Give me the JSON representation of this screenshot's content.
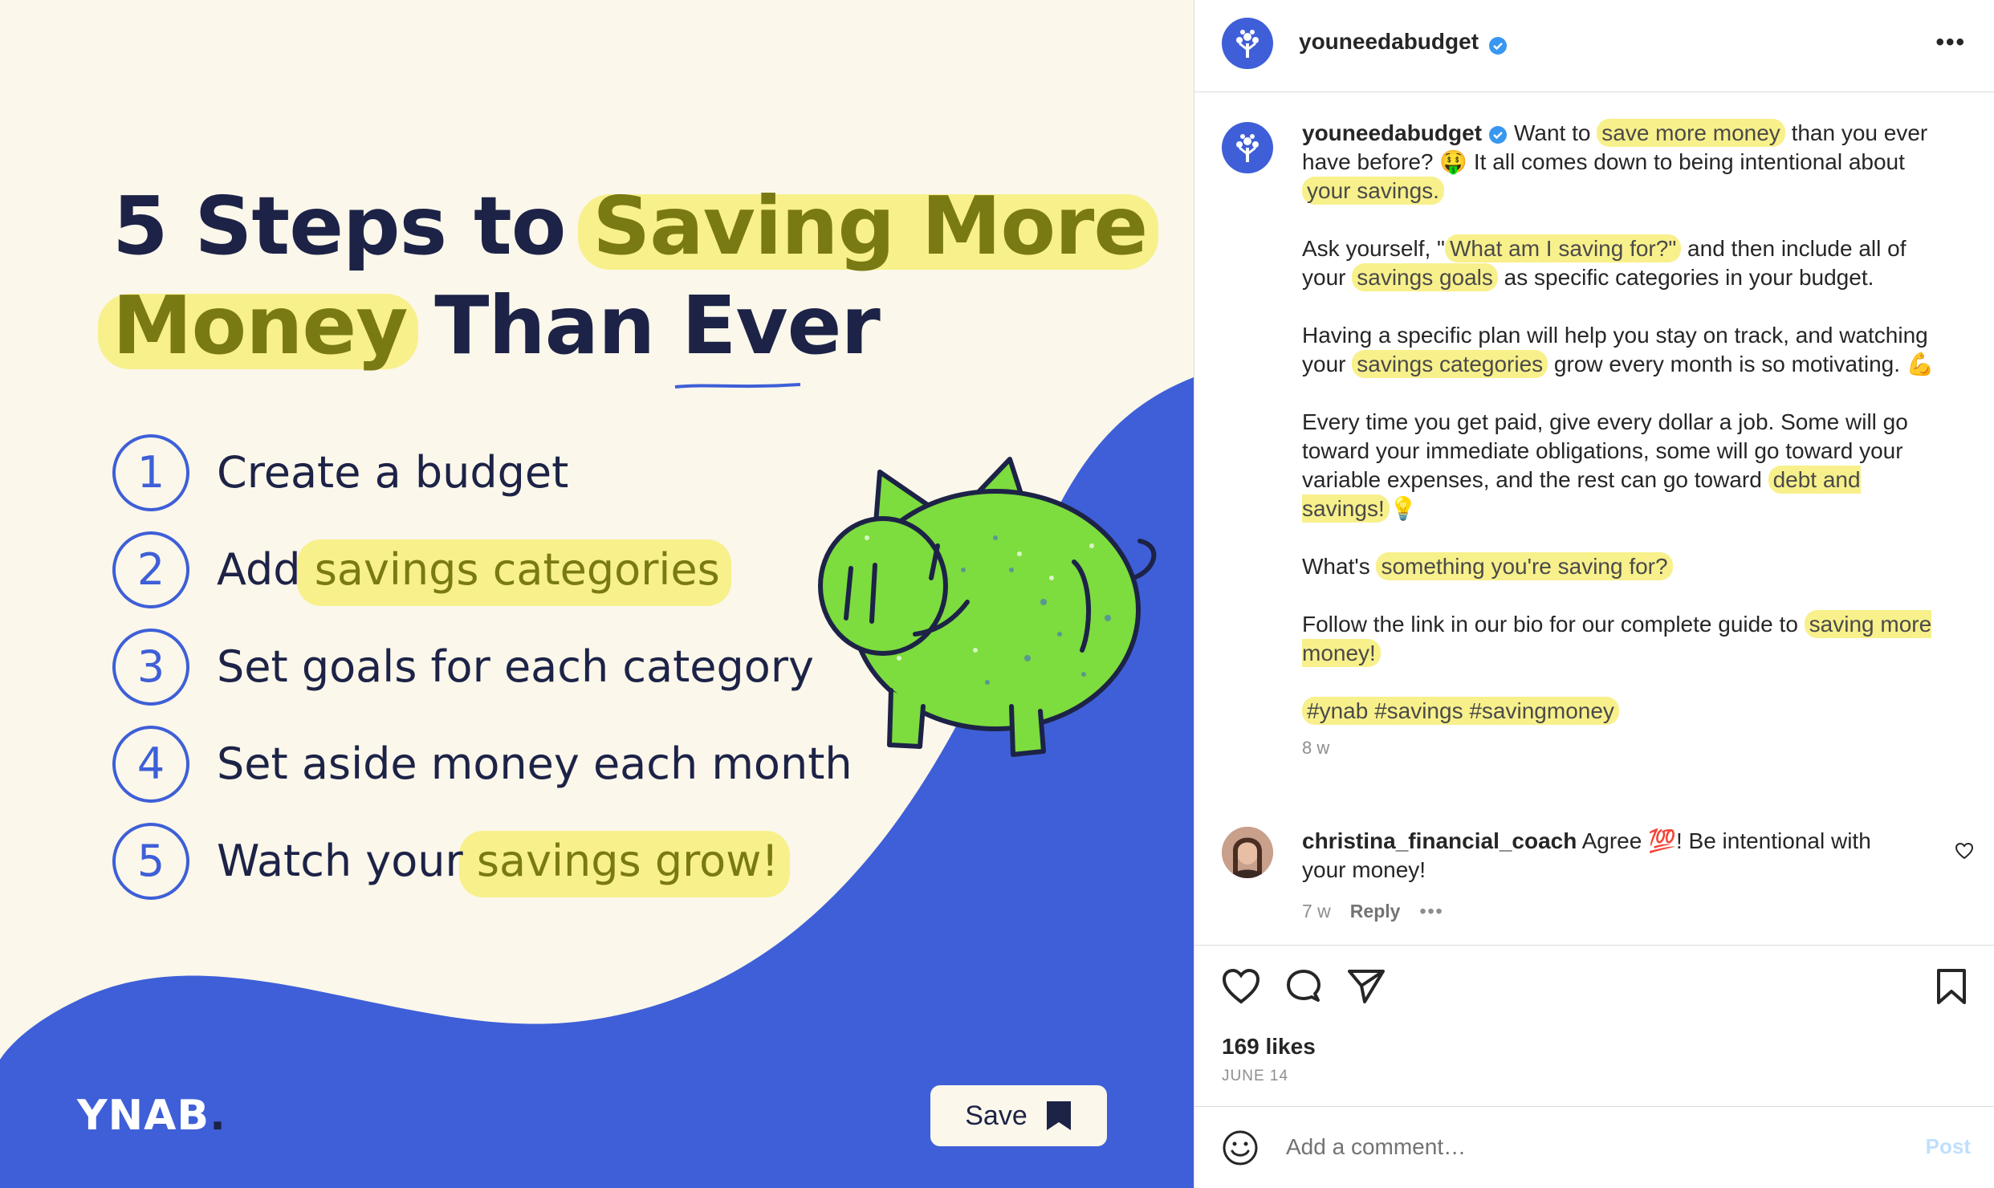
{
  "image": {
    "headline_line1_plain": "5 Steps to ",
    "headline_line1_hl": "Saving More",
    "headline_line2_hl": "Money",
    "headline_line2_plain": " Than ",
    "headline_line2_ever": "Ever",
    "steps": [
      {
        "num": "1",
        "plain": "Create a budget",
        "hl": ""
      },
      {
        "num": "2",
        "plain": "Add ",
        "hl": "savings categories"
      },
      {
        "num": "3",
        "plain": "Set goals for each category",
        "hl": ""
      },
      {
        "num": "4",
        "plain": "Set aside money each month",
        "hl": ""
      },
      {
        "num": "5",
        "plain": "Watch your ",
        "hl": "savings grow!"
      }
    ],
    "logo": "YNAB",
    "logo_dot": ".",
    "save_label": "Save"
  },
  "header": {
    "username": "youneedabudget",
    "more_label": "•••"
  },
  "caption": {
    "username": "youneedabudget",
    "p1": [
      "Want to ",
      "save more money",
      " than you ever have before? 🤑 It all comes down to being intentional about ",
      "your savings."
    ],
    "p2": [
      "Ask yourself, \"",
      "What am I saving for?\"",
      " and then include all of your ",
      "savings goals",
      " as specific categories in your budget."
    ],
    "p3": [
      "Having a specific plan will help you stay on track, and watching your ",
      "savings categories",
      " grow every month is so motivating. 💪"
    ],
    "p4": [
      "Every time you get paid, give every dollar a job. Some will go toward your immediate obligations, some will go toward your variable expenses, and the rest can go toward ",
      "debt and savings!",
      "💡"
    ],
    "p5": [
      "What's ",
      "something you're saving for?"
    ],
    "p6": [
      "Follow the link in our bio for our complete guide to ",
      "saving more money!"
    ],
    "hashtags": "#ynab #savings #savingmoney",
    "time": "8 w"
  },
  "comment": {
    "username": "christina_financial_coach",
    "text": " Agree 💯! Be intentional with your money!",
    "time": "7 w",
    "reply": "Reply",
    "more": "•••"
  },
  "stats": {
    "likes": "169 likes",
    "date": "JUNE 14"
  },
  "comment_box": {
    "placeholder": "Add a comment…",
    "post_label": "Post"
  },
  "colors": {
    "brand_blue": "#3e5fd8",
    "highlight_yellow": "#f8f08b",
    "cream": "#fbf7ea",
    "pig_green": "#7ddc3e",
    "navy": "#1d2347"
  }
}
